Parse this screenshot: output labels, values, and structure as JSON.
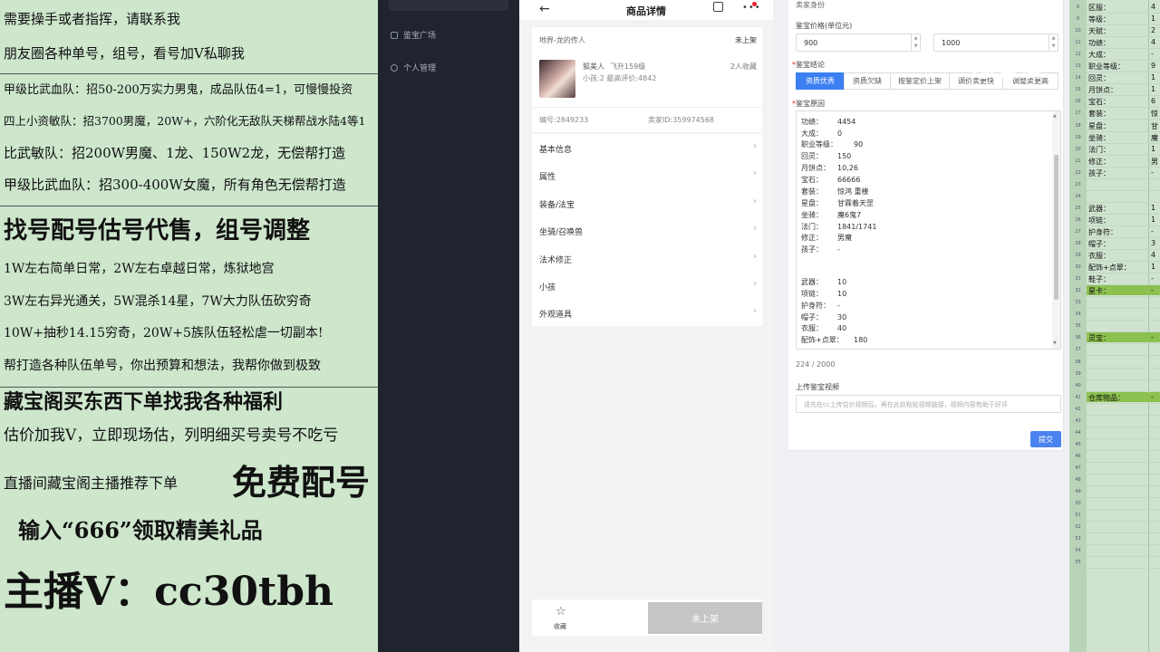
{
  "overlay": {
    "lines": [
      "需要操手或者指挥，请联系我",
      "朋友圈各种单号，组号，看号加V私聊我",
      "甲级比武血队：招50-200万实力男鬼，成品队伍4=1，可慢慢投资",
      "四上小资敏队：招3700男魔，20W+，六阶化无敌队天梯帮战水陆4等1",
      "比武敏队：招200W男魔、1龙、150W2龙，无偿帮打造",
      "甲级比武血队：招300-400W女魔，所有角色无偿帮打造",
      "找号配号估号代售，组号调整",
      "1W左右简单日常，2W左右卓越日常，炼狱地宫",
      "3W左右异光通关，5W混杀14星，7W大力队伍砍穷奇",
      "10W+抽秒14.15穷奇，20W+5族队伍轻松虐一切副本!",
      "帮打造各种队伍单号，你出预算和想法，我帮你做到极致",
      "藏宝阁买东西下单找我各种福利",
      "估价加我V，立即现场估，列明细买号卖号不吃亏",
      "直播间藏宝阁主播推荐下单",
      "免费配号",
      "输入“666”领取精美礼品",
      "主播V：cc30tbh"
    ]
  },
  "darknav": {
    "items": [
      "鉴宝广场",
      "个人管理"
    ]
  },
  "phone": {
    "title": "商品详情",
    "back_icon": "←",
    "more_icon": "•••",
    "card": {
      "server": "地界-龙的传人",
      "status": "未上架",
      "name": "狐美人",
      "level": "飞升159级",
      "favorites": "2人收藏",
      "sub": "小孩:2 最高评价:4842",
      "item_no": "编号:2849233",
      "seller_id": "卖家ID:359974568"
    },
    "menu": [
      "基本信息",
      "属性",
      "装备/法宝",
      "坐骑/召唤兽",
      "法术修正",
      "小孩",
      "外观道具"
    ],
    "chevron": "›",
    "bottom": {
      "fav_label": "收藏",
      "star_icon": "☆",
      "off_button": "未上架"
    }
  },
  "form": {
    "seller_label": "卖家身份",
    "price_label": "鉴宝价格(单位元)",
    "price_min": "900",
    "price_max": "1000",
    "req_mark": "*",
    "conclusion_label": "鉴宝结论",
    "tabs": [
      "资质优秀",
      "资质欠缺",
      "按鉴定价上架",
      "调价卖更快",
      "调整卖更高"
    ],
    "reason_label": "鉴宝原因",
    "reason_lines": [
      {
        "k": "功绩：",
        "v": "4454"
      },
      {
        "k": "大成：",
        "v": "0"
      },
      {
        "k": "职业等级：",
        "v": "90"
      },
      {
        "k": "回灵：",
        "v": "150"
      },
      {
        "k": "月饼点：",
        "v": "10,26"
      },
      {
        "k": "宝石：",
        "v": "66666"
      },
      {
        "k": "套装：",
        "v": "惊鸿 重楼"
      },
      {
        "k": "星盘：",
        "v": "甘霖着天罡"
      },
      {
        "k": "坐骑：",
        "v": "魔6鬼7"
      },
      {
        "k": "法门：",
        "v": "1841/1741"
      },
      {
        "k": "修正：",
        "v": "男魔"
      },
      {
        "k": "孩子：",
        "v": "-"
      },
      {
        "k": "武器：",
        "v": "10"
      },
      {
        "k": "项链：",
        "v": "10"
      },
      {
        "k": "护身符：",
        "v": "-"
      },
      {
        "k": "帽子：",
        "v": "30"
      },
      {
        "k": "衣服：",
        "v": "40"
      },
      {
        "k": "配饰+点翠：",
        "v": "180"
      }
    ],
    "counter": "224 / 2000",
    "upload_label": "上传鉴宝视频",
    "upload_placeholder": "请先在cc上传估价视频后，再在此处粘贴视频链接，视频内容有助于好评",
    "submit": "提交"
  },
  "sheet": {
    "rows": [
      {
        "n": "8",
        "a": "区服：",
        "b": "4"
      },
      {
        "n": "9",
        "a": "等级：",
        "b": "1"
      },
      {
        "n": "10",
        "a": "天赋：",
        "b": "2"
      },
      {
        "n": "11",
        "a": "功绩：",
        "b": "4"
      },
      {
        "n": "12",
        "a": "大成：",
        "b": "-"
      },
      {
        "n": "13",
        "a": "职业等级：",
        "b": "9"
      },
      {
        "n": "14",
        "a": "回灵：",
        "b": "1"
      },
      {
        "n": "15",
        "a": "月饼点：",
        "b": "1"
      },
      {
        "n": "16",
        "a": "宝石：",
        "b": "6"
      },
      {
        "n": "17",
        "a": "套装：",
        "b": "惊"
      },
      {
        "n": "18",
        "a": "星盘：",
        "b": "甘"
      },
      {
        "n": "19",
        "a": "坐骑：",
        "b": "魔"
      },
      {
        "n": "20",
        "a": "法门：",
        "b": "1"
      },
      {
        "n": "21",
        "a": "修正：",
        "b": "男"
      },
      {
        "n": "22",
        "a": "孩子：",
        "b": "-"
      },
      {
        "n": "23",
        "a": "",
        "b": ""
      },
      {
        "n": "24",
        "a": "",
        "b": ""
      },
      {
        "n": "25",
        "a": "武器：",
        "b": "1"
      },
      {
        "n": "26",
        "a": "项链：",
        "b": "1"
      },
      {
        "n": "27",
        "a": "护身符：",
        "b": "-"
      },
      {
        "n": "28",
        "a": "帽子：",
        "b": "3"
      },
      {
        "n": "29",
        "a": "衣服：",
        "b": "4"
      },
      {
        "n": "30",
        "a": "配饰+点翠：",
        "b": "1"
      },
      {
        "n": "31",
        "a": "鞋子：",
        "b": "-"
      },
      {
        "n": "32",
        "a": "星卡：",
        "b": "-"
      },
      {
        "n": "33",
        "a": "",
        "b": ""
      },
      {
        "n": "34",
        "a": "",
        "b": ""
      },
      {
        "n": "35",
        "a": "",
        "b": ""
      },
      {
        "n": "36",
        "a": "灵宝：",
        "b": "-"
      },
      {
        "n": "37",
        "a": "",
        "b": ""
      },
      {
        "n": "38",
        "a": "",
        "b": ""
      },
      {
        "n": "39",
        "a": "",
        "b": ""
      },
      {
        "n": "40",
        "a": "",
        "b": ""
      },
      {
        "n": "41",
        "a": "仓库物品：",
        "b": "-"
      },
      {
        "n": "42",
        "a": "",
        "b": ""
      },
      {
        "n": "43",
        "a": "",
        "b": ""
      },
      {
        "n": "44",
        "a": "",
        "b": ""
      },
      {
        "n": "45",
        "a": "",
        "b": ""
      },
      {
        "n": "46",
        "a": "",
        "b": ""
      },
      {
        "n": "47",
        "a": "",
        "b": ""
      },
      {
        "n": "48",
        "a": "",
        "b": ""
      },
      {
        "n": "49",
        "a": "",
        "b": ""
      },
      {
        "n": "50",
        "a": "",
        "b": ""
      },
      {
        "n": "51",
        "a": "",
        "b": ""
      },
      {
        "n": "52",
        "a": "",
        "b": ""
      },
      {
        "n": "53",
        "a": "",
        "b": ""
      },
      {
        "n": "54",
        "a": "",
        "b": ""
      },
      {
        "n": "55",
        "a": "",
        "b": ""
      }
    ],
    "highlight_color": "#8cc04f"
  },
  "watermark": {
    "text": "直播"
  },
  "colors": {
    "accent": "#3b7ff2",
    "overlay_bg": "#cde6cc",
    "nav_bg": "#20242e"
  }
}
